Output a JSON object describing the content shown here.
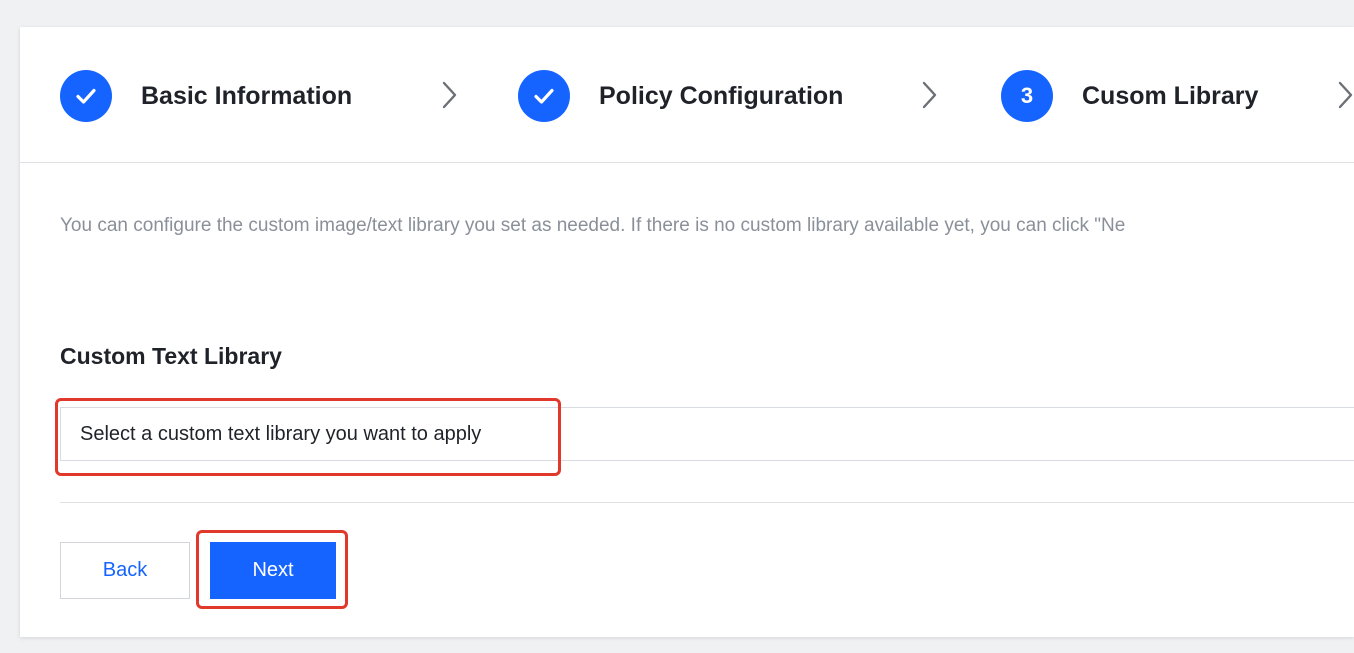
{
  "steps": [
    {
      "status": "done",
      "label": "Basic Information"
    },
    {
      "status": "done",
      "label": "Policy Configuration"
    },
    {
      "status": "current",
      "number": "3",
      "label": "Cusom Library"
    }
  ],
  "intro_text": "You can configure the custom image/text library you set as needed. If there is no custom library available yet, you can click \"Ne",
  "custom_text_library": {
    "title": "Custom Text Library",
    "select_placeholder": "Select a custom text library you want to apply"
  },
  "actions": {
    "back_label": "Back",
    "next_label": "Next"
  },
  "colors": {
    "primary": "#1664ff",
    "highlight": "#e0382b",
    "muted_text": "#8a9099"
  }
}
